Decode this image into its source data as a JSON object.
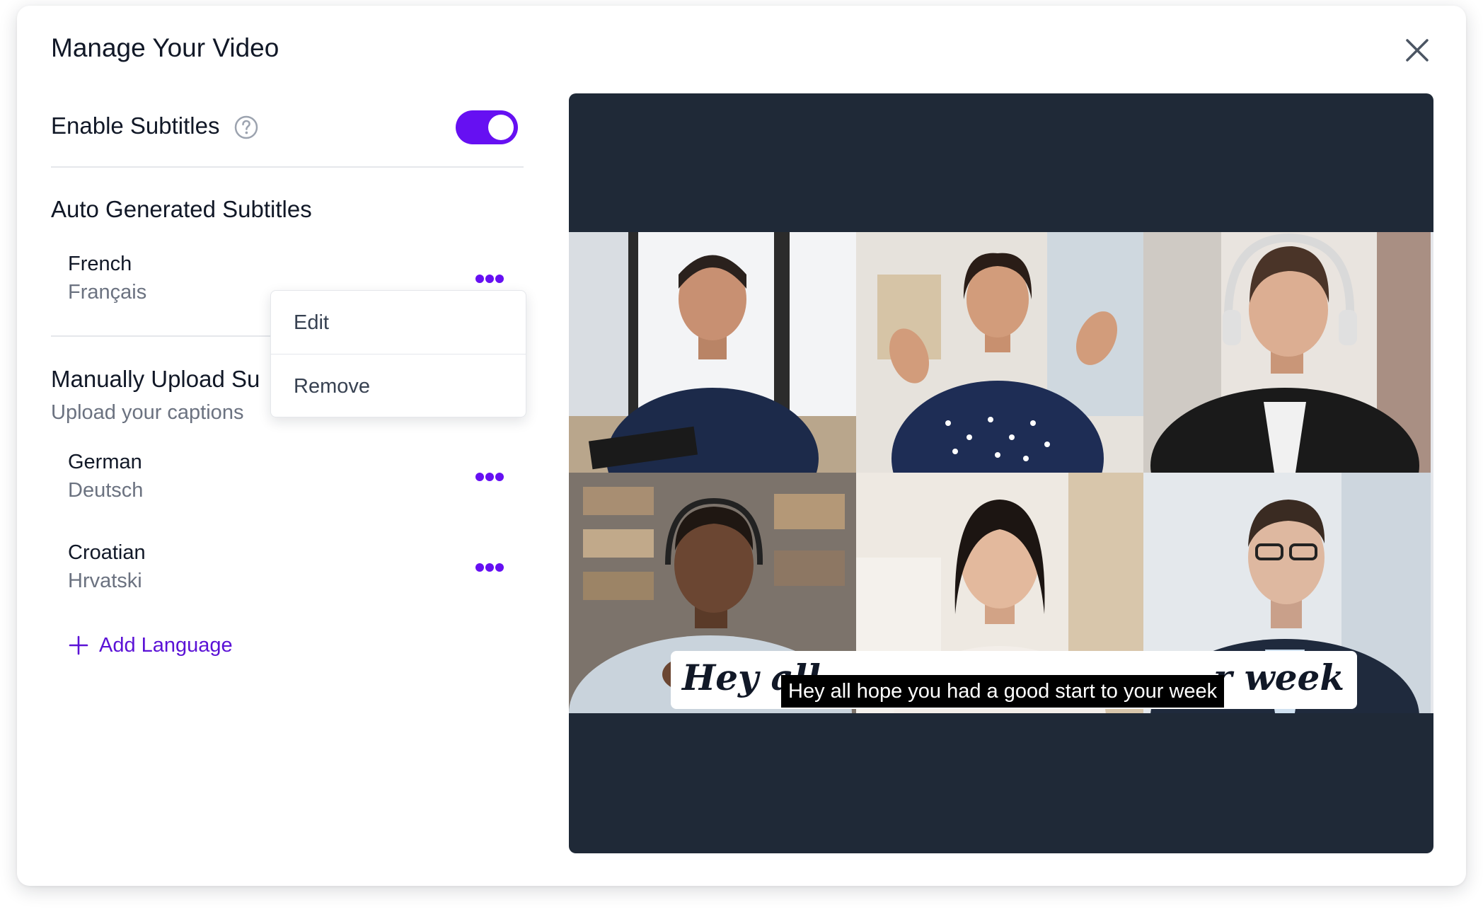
{
  "modal": {
    "title": "Manage Your Video",
    "close_icon": "close-icon"
  },
  "subtitles_toggle": {
    "label": "Enable Subtitles",
    "help_icon": "question-circle-icon",
    "enabled": true,
    "accent_color": "#6610f2"
  },
  "auto_generated": {
    "title": "Auto Generated Subtitles",
    "languages": [
      {
        "name": "French",
        "native": "Français"
      }
    ]
  },
  "manual_upload": {
    "title": "Manually Upload Su",
    "subtitle": "Upload your captions",
    "languages": [
      {
        "name": "German",
        "native": "Deutsch"
      },
      {
        "name": "Croatian",
        "native": "Hrvatski"
      }
    ],
    "add_label": "Add Language"
  },
  "dropdown_menu": {
    "items": [
      "Edit",
      "Remove"
    ]
  },
  "video": {
    "burned_caption_left": "Hey all",
    "burned_caption_right": "r week",
    "caption_overlay": "Hey all hope you had a good start to your week",
    "player_background": "#1f2937"
  }
}
